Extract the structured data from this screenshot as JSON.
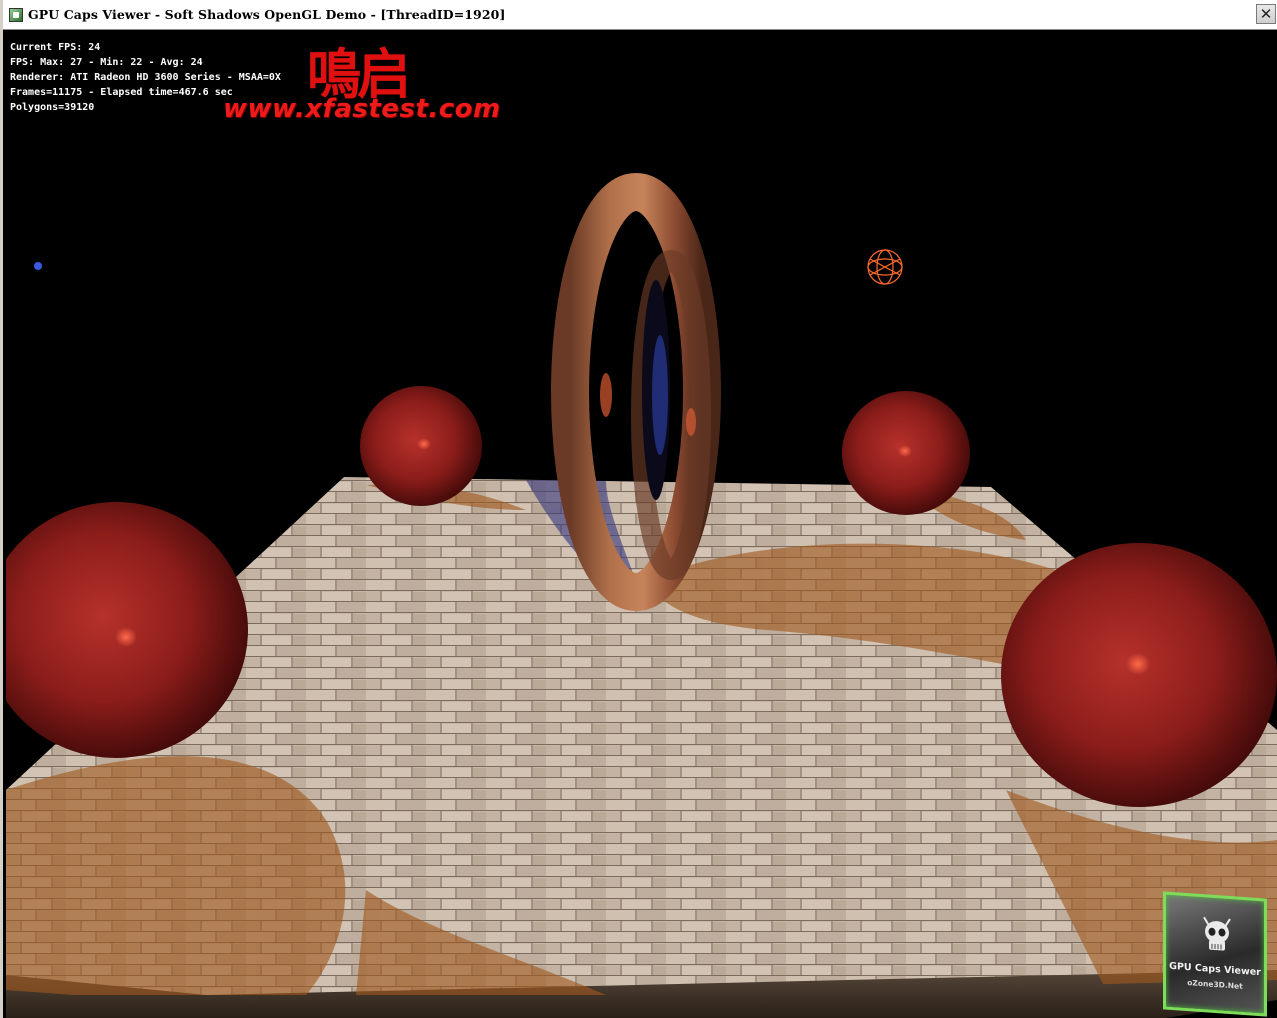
{
  "window": {
    "title": "GPU Caps Viewer - Soft Shadows OpenGL Demo - [ThreadID=1920]",
    "close_glyph": "✕"
  },
  "hud": {
    "line1": "Current FPS: 24",
    "line2": "FPS: Max: 27 - Min: 22 - Avg: 24",
    "line3": "Renderer: ATI Radeon HD 3600 Series - MSAA=0X",
    "line4": "Frames=11175 - Elapsed time=467.6 sec",
    "line5": "Polygons=39120"
  },
  "watermark": {
    "cjk": "鳴启",
    "url": "www.xfastest.com"
  },
  "badge": {
    "title": "GPU Caps Viewer",
    "subtitle": "oZone3D.Net"
  },
  "colors": {
    "sphere": "#8e1e1c",
    "floor_light": "#c9b8a8",
    "floor_shadow": "#a8662e",
    "badge_border": "#7ddc5a",
    "watermark": "#e11010"
  }
}
